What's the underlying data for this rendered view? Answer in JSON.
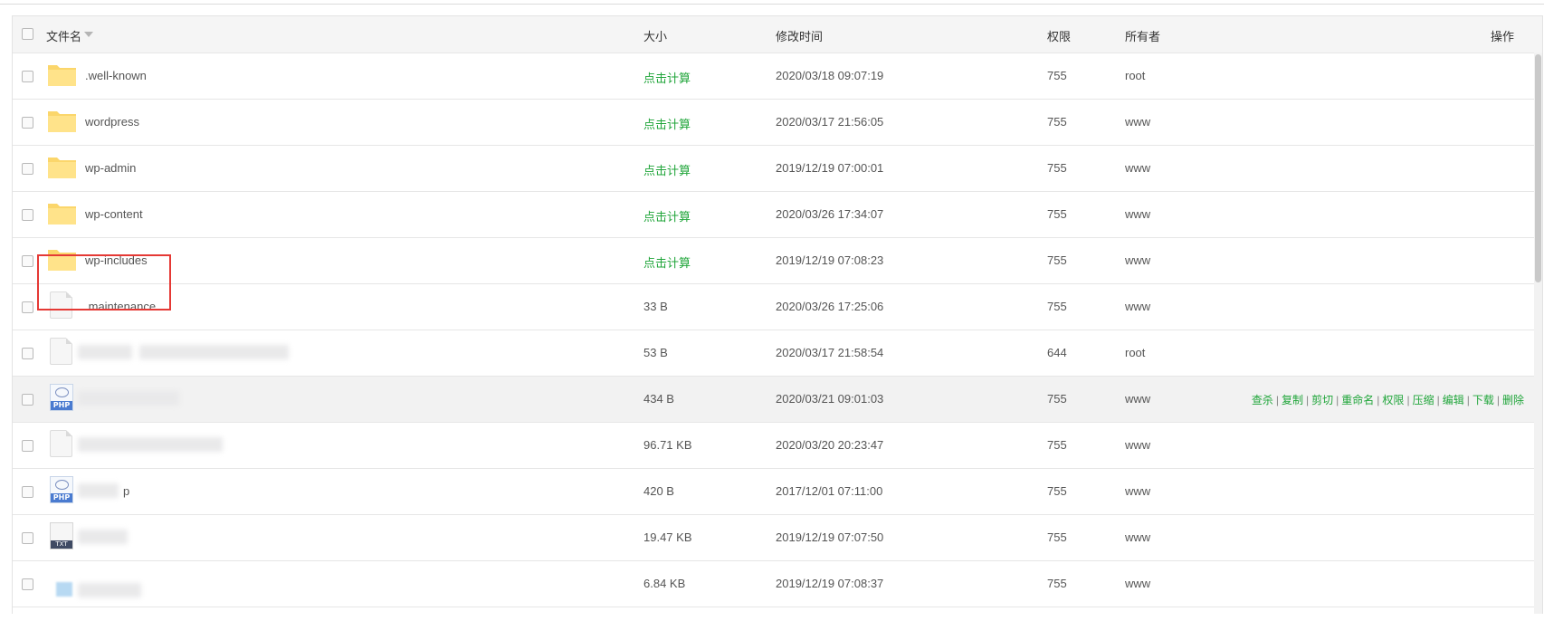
{
  "table": {
    "headers": {
      "name": "文件名",
      "size": "大小",
      "mtime": "修改时间",
      "perm": "权限",
      "owner": "所有者",
      "ops": "操作"
    },
    "rows": [
      {
        "type": "folder",
        "name": ".well-known",
        "size": "点击计算",
        "mtime": "2020/03/18 09:07:19",
        "perm": "755",
        "owner": "root"
      },
      {
        "type": "folder",
        "name": "wordpress",
        "size": "点击计算",
        "mtime": "2020/03/17 21:56:05",
        "perm": "755",
        "owner": "www"
      },
      {
        "type": "folder",
        "name": "wp-admin",
        "size": "点击计算",
        "mtime": "2019/12/19 07:00:01",
        "perm": "755",
        "owner": "www"
      },
      {
        "type": "folder",
        "name": "wp-content",
        "size": "点击计算",
        "mtime": "2020/03/26 17:34:07",
        "perm": "755",
        "owner": "www"
      },
      {
        "type": "folder",
        "name": "wp-includes",
        "size": "点击计算",
        "mtime": "2019/12/19 07:08:23",
        "perm": "755",
        "owner": "www"
      },
      {
        "type": "file",
        "name": ".maintenance",
        "size": "33 B",
        "mtime": "2020/03/26 17:25:06",
        "perm": "755",
        "owner": "www"
      },
      {
        "type": "file",
        "name": "",
        "size": "53 B",
        "mtime": "2020/03/17 21:58:54",
        "perm": "644",
        "owner": "root"
      },
      {
        "type": "php",
        "name": "",
        "size": "434 B",
        "mtime": "2020/03/21 09:01:03",
        "perm": "755",
        "owner": "www"
      },
      {
        "type": "file",
        "name": "",
        "size": "96.71 KB",
        "mtime": "2020/03/20 20:23:47",
        "perm": "755",
        "owner": "www"
      },
      {
        "type": "php",
        "name": "p",
        "size": "420 B",
        "mtime": "2017/12/01 07:11:00",
        "perm": "755",
        "owner": "www"
      },
      {
        "type": "txt",
        "name": "",
        "size": "19.47 KB",
        "mtime": "2019/12/19 07:07:50",
        "perm": "755",
        "owner": "www"
      },
      {
        "type": "image",
        "name": "",
        "size": "6.84 KB",
        "mtime": "2019/12/19 07:08:37",
        "perm": "755",
        "owner": "www"
      }
    ],
    "row_actions": [
      "查杀",
      "复制",
      "剪切",
      "重命名",
      "权限",
      "压缩",
      "编辑",
      "下载",
      "删除"
    ],
    "icon_labels": {
      "php": "PHP",
      "txt": "TXT"
    },
    "colors": {
      "accent": "#20a53a",
      "highlight": "#e53935"
    }
  }
}
